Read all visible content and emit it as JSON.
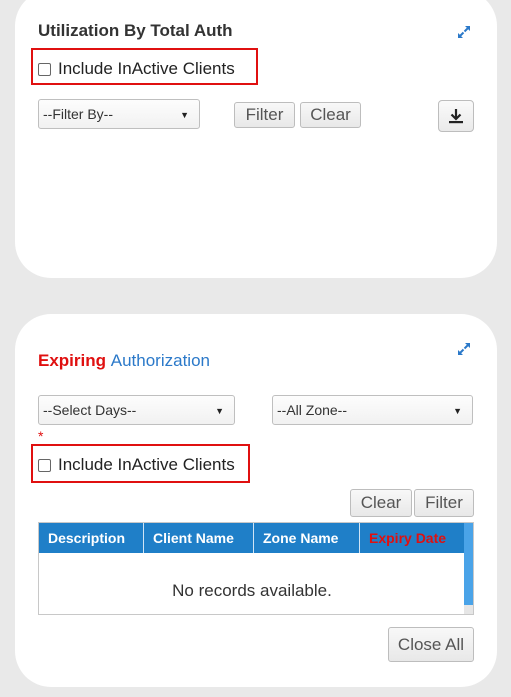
{
  "card_utilization": {
    "title": "Utilization By Total Auth",
    "include_inactive_label": "Include InActive Clients",
    "filter_select_value": "--Filter By--",
    "filter_button": "Filter",
    "clear_button": "Clear"
  },
  "card_expiring": {
    "title_part1": "Expiring",
    "title_part2": "Authorization",
    "days_select_value": "--Select Days--",
    "zone_select_value": "--All Zone--",
    "required_marker": "*",
    "include_inactive_label": "Include InActive Clients",
    "clear_button": "Clear",
    "filter_button": "Filter",
    "grid": {
      "columns": [
        "Description",
        "Client Name",
        "Zone Name",
        "Expiry Date"
      ],
      "empty_message": "No records available."
    },
    "close_all_button": "Close All"
  },
  "colors": {
    "accent_blue": "#1f7fc8",
    "highlight_red": "#e01010",
    "expiry_header_red": "#e01010"
  },
  "icons": [
    "expand-icon",
    "download-icon",
    "checkbox",
    "chevron-down-icon"
  ]
}
